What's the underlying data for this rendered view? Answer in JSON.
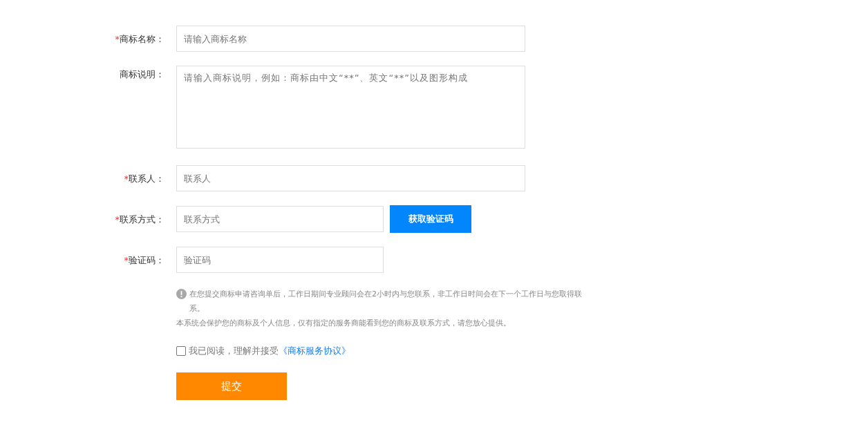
{
  "fields": [
    {
      "asterisk": "*",
      "label": "商标名称：",
      "kind": "input",
      "placeholder": "请输入商标名称"
    },
    {
      "label": "商标说明：",
      "kind": "textarea",
      "placeholder": "请输入商标说明，例如：商标由中文“**”、英文“**”以及图形构成"
    },
    {
      "asterisk": "*",
      "label": "联系人：",
      "kind": "input",
      "placeholder": "联系人"
    },
    {
      "asterisk": "*",
      "label": "联系方式：",
      "kind": "short",
      "placeholder": "联系方式",
      "button": "获取验证码"
    },
    {
      "asterisk": "*",
      "label": "验证码：",
      "kind": "short",
      "placeholder": "验证码"
    }
  ],
  "notice": {
    "lines": [
      "在您提交商标申请咨询单后，工作日期间专业顾问会在2小时内与您联系，非工作日时间会在下一个工作日与您取得联系。",
      "本系统会保护您的商标及个人信息，仅有指定的服务商能看到您的商标及联系方式，请您放心提供。"
    ]
  },
  "agreement": {
    "checked": false,
    "text": "我已阅读，理解并接受",
    "link": "《商标服务协议》"
  },
  "submit": "提交"
}
